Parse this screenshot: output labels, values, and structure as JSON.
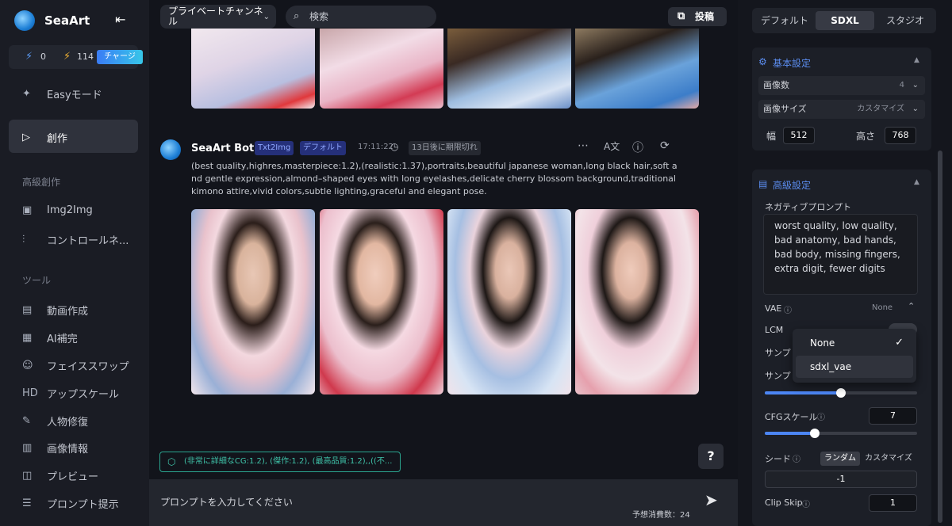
{
  "sidebar": {
    "brand": "SeaArt",
    "credit_a": "0",
    "credit_b": "114",
    "charge_label": "チャージ",
    "items": [
      {
        "label": "Easyモード"
      },
      {
        "label": "創作"
      },
      {
        "label": "Img2Img"
      },
      {
        "label": "コントロールネ..."
      },
      {
        "label": "動画作成"
      },
      {
        "label": "AI補完"
      },
      {
        "label": "フェイススワップ"
      },
      {
        "label": "アップスケール"
      },
      {
        "label": "人物修復"
      },
      {
        "label": "画像情報"
      },
      {
        "label": "プレビュー"
      },
      {
        "label": "プロンプト提示"
      }
    ],
    "section_advanced": "高級創作",
    "section_tools": "ツール"
  },
  "header": {
    "channel": "プライベートチャンネル",
    "search_placeholder": "検索",
    "post_label": "投稿"
  },
  "message": {
    "bot_name": "SeaArt Bot",
    "tag_mode": "Txt2Img",
    "tag_preset": "デフォルト",
    "time": "17:11:22",
    "expire": "13日後に期限切れ",
    "prompt": "(best quality,highres,masterpiece:1.2),(realistic:1.37),portraits,beautiful japanese woman,long black hair,soft and gentle expression,almond–shaped eyes with long eyelashes,delicate cherry blossom background,traditional kimono attire,vivid colors,subtle lighting,graceful and elegant pose."
  },
  "suggestion": "(非常に詳細なCG:1.2), (傑作:1.2), (最高品質:1.2),,((不...",
  "composer": {
    "placeholder": "プロンプトを入力してください",
    "cost": "予想消費数：24"
  },
  "settings": {
    "tabs": [
      "デフォルト",
      "SDXL",
      "スタジオ"
    ],
    "basic_title": "基本設定",
    "image_count_label": "画像数",
    "image_count_value": "4",
    "image_size_label": "画像サイズ",
    "image_size_value": "カスタマイズ",
    "width_label": "幅",
    "width_value": "512",
    "height_label": "高さ",
    "height_value": "768",
    "advanced_title": "高級設定",
    "negative_label": "ネガティブプロンプト",
    "negative_text": "worst quality, low quality,  bad anatomy, bad hands, bad body, missing fingers, extra digit, fewer digits",
    "vae_label": "VAE",
    "vae_value": "None",
    "lcm_label": "LCM",
    "sampler_label": "サンプ",
    "steps_label": "サンプ",
    "cfg_label": "CFGスケール",
    "cfg_value": "7",
    "seed_label": "シード",
    "seed_random": "ランダム",
    "seed_custom": "カスタマイズ",
    "seed_value": "-1",
    "clip_label": "Clip Skip",
    "clip_value": "1",
    "vae_options": [
      "None",
      "sdxl_vae"
    ],
    "steps_level": 0.5,
    "cfg_level": 0.33
  },
  "help_label": "?",
  "colors": {
    "accent": "#4c86f5",
    "tag_bg": "#25307a",
    "suggest": "#2aa58f"
  }
}
